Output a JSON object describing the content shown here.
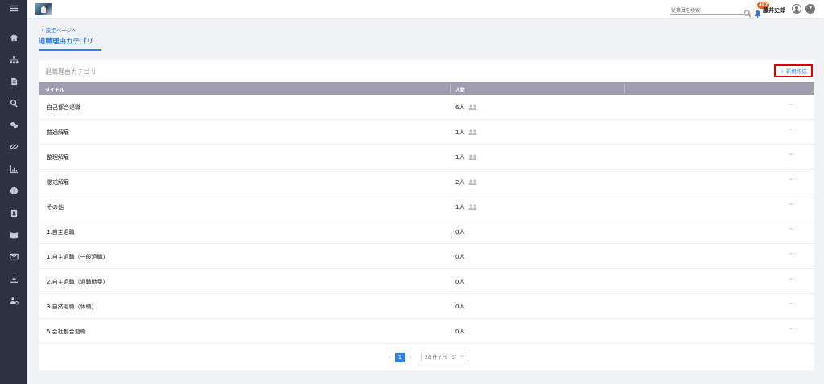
{
  "header": {
    "search_placeholder": "従業員を検索",
    "notification_count": "387",
    "user_name": "藤井史郎",
    "help_label": "?"
  },
  "breadcrumb": {
    "back_label": "〈 設定ページへ"
  },
  "page": {
    "title": "退職理由カテゴリ"
  },
  "card": {
    "title": "退職理由カテゴリ",
    "new_button_label": "+ 新規作成"
  },
  "table": {
    "columns": {
      "title": "タイトル",
      "count": "人数"
    },
    "rows": [
      {
        "title": "自己都合退職",
        "count": "6人",
        "has_people_icon": true
      },
      {
        "title": "普通解雇",
        "count": "1人",
        "has_people_icon": true
      },
      {
        "title": "整理解雇",
        "count": "1人",
        "has_people_icon": true
      },
      {
        "title": "懲戒解雇",
        "count": "2人",
        "has_people_icon": true
      },
      {
        "title": "その他",
        "count": "1人",
        "has_people_icon": true
      },
      {
        "title": "1.自主退職",
        "count": "0人",
        "has_people_icon": false
      },
      {
        "title": "1.自主退職（一般退職）",
        "count": "0人",
        "has_people_icon": false
      },
      {
        "title": "2.自主退職（退職勧奨）",
        "count": "0人",
        "has_people_icon": false
      },
      {
        "title": "3.自然退職（休職）",
        "count": "0人",
        "has_people_icon": false
      },
      {
        "title": "5.会社都合退職",
        "count": "0人",
        "has_people_icon": false
      }
    ],
    "row_action_label": "···"
  },
  "pagination": {
    "prev": "‹",
    "current_page": "1",
    "next": "›",
    "page_size": "20 件 / ページ",
    "page_size_chevron": "﹀"
  },
  "sidebar": {
    "icons": [
      "menu-icon",
      "home-icon",
      "org-chart-icon",
      "document-icon",
      "search-icon",
      "chat-icon",
      "link-icon",
      "chart-icon",
      "info-icon",
      "contacts-icon",
      "book-icon",
      "mail-icon",
      "download-icon",
      "user-settings-icon"
    ]
  }
}
